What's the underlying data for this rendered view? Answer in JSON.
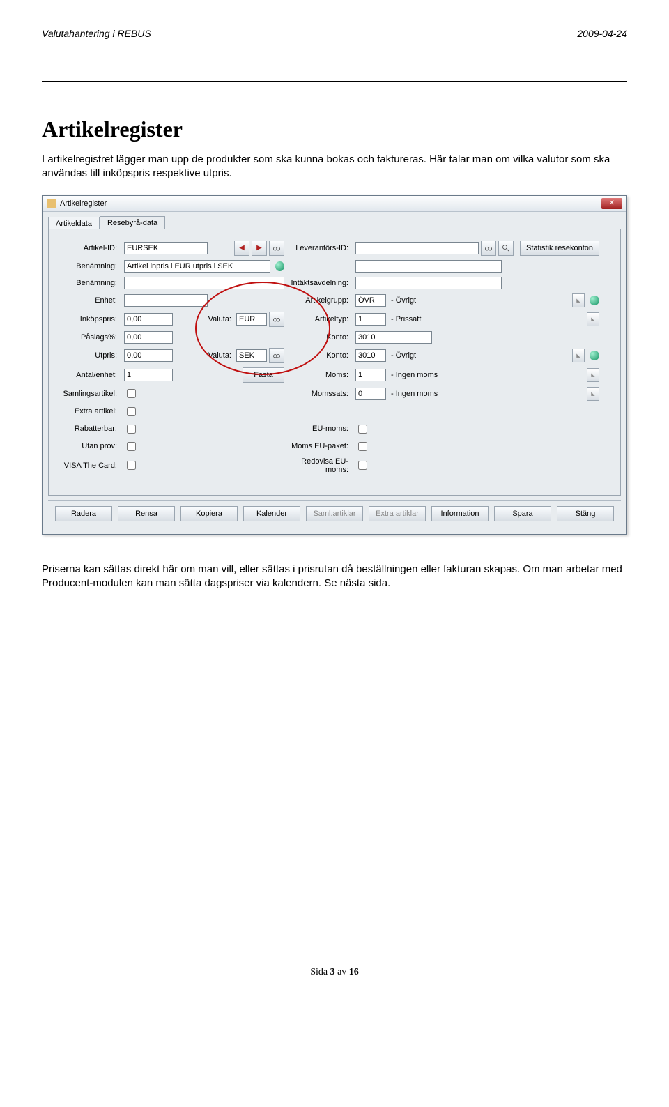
{
  "doc": {
    "header_left": "Valutahantering i REBUS",
    "header_right": "2009-04-24",
    "title": "Artikelregister",
    "para1": "I artikelregistret lägger man upp de produkter som ska kunna bokas och faktureras. Här talar man om vilka valutor som ska användas till inköpspris respektive utpris.",
    "para2": "Priserna kan sättas direkt här om man vill, eller sättas i prisrutan då beställningen eller fakturan skapas. Om man arbetar med Producent-modulen kan man sätta dagspriser via kalendern. Se nästa sida.",
    "footer_prefix": "Sida ",
    "footer_page": "3",
    "footer_mid": " av ",
    "footer_total": "16"
  },
  "win": {
    "title": "Artikelregister",
    "tabs": [
      "Artikeldata",
      "Resebyrå-data"
    ],
    "labels": {
      "artikelid": "Artikel-ID:",
      "leverantorsid": "Leverantörs-ID:",
      "benamning": "Benämning:",
      "benamning2": "Benämning:",
      "intaktsavdelning": "Intäktsavdelning:",
      "enhet": "Enhet:",
      "artikelgrupp": "Artikelgrupp:",
      "inkopspris": "Inköpspris:",
      "valuta": "Valuta:",
      "artikeltyp": "Artikeltyp:",
      "paslag": "Påslags%:",
      "konto": "Konto:",
      "utpris": "Utpris:",
      "antalenhet": "Antal/enhet:",
      "fasta": "Fasta",
      "moms": "Moms:",
      "samlingsartikel": "Samlingsartikel:",
      "momssats": "Momssats:",
      "extraartikel": "Extra artikel:",
      "rabatterbar": "Rabatterbar:",
      "eumoms": "EU-moms:",
      "utanprov": "Utan prov:",
      "momseupaket": "Moms EU-paket:",
      "visathecard": "VISA The Card:",
      "redovisaeumoms": "Redovisa EU-moms:",
      "statistik": "Statistik resekonton"
    },
    "values": {
      "artikelid": "EURSEK",
      "benamning": "Artikel inpris i EUR utpris i SEK",
      "inkopspris": "0,00",
      "valuta1": "EUR",
      "valuta2": "SEK",
      "paslag": "0,00",
      "utpris": "0,00",
      "antalenhet": "1",
      "artikelgrupp": "ÖVR",
      "artikelgrupp_desc": "- Övrigt",
      "artikeltyp": "1",
      "artikeltyp_desc": "- Prissatt",
      "konto1": "3010",
      "konto2": "3010",
      "konto2_desc": "- Övrigt",
      "moms": "1",
      "moms_desc": "- Ingen moms",
      "momssats": "0",
      "momssats_desc": "- Ingen moms"
    },
    "buttons": [
      "Radera",
      "Rensa",
      "Kopiera",
      "Kalender",
      "Saml.artiklar",
      "Extra artiklar",
      "Information",
      "Spara",
      "Stäng"
    ]
  }
}
